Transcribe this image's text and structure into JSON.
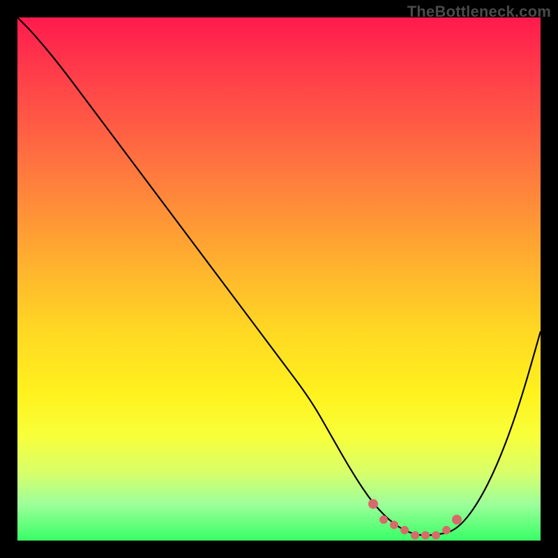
{
  "watermark": "TheBottleneck.com",
  "colors": {
    "frame": "#000000",
    "curve": "#000000",
    "marker": "#d76a6a"
  },
  "chart_data": {
    "type": "line",
    "title": "",
    "xlabel": "",
    "ylabel": "",
    "xlim": [
      0,
      100
    ],
    "ylim": [
      0,
      100
    ],
    "grid": false,
    "legend": false,
    "series": [
      {
        "name": "bottleneck-curve",
        "x": [
          0,
          3,
          8,
          14,
          20,
          26,
          32,
          38,
          44,
          50,
          56,
          60,
          64,
          68,
          72,
          76,
          80,
          84,
          88,
          92,
          96,
          100
        ],
        "values": [
          100,
          97,
          91,
          83,
          75,
          67,
          59,
          51,
          43,
          35,
          27,
          20,
          13,
          7,
          3,
          1,
          1,
          2,
          7,
          15,
          26,
          40
        ]
      }
    ],
    "markers": [
      {
        "name": "sweet-spot-start",
        "x": 68,
        "y": 7
      },
      {
        "name": "sweet-spot",
        "x": 70,
        "y": 4
      },
      {
        "name": "sweet-spot",
        "x": 72,
        "y": 3
      },
      {
        "name": "sweet-spot",
        "x": 74,
        "y": 2
      },
      {
        "name": "sweet-spot",
        "x": 76,
        "y": 1
      },
      {
        "name": "sweet-spot",
        "x": 78,
        "y": 1
      },
      {
        "name": "sweet-spot",
        "x": 80,
        "y": 1
      },
      {
        "name": "sweet-spot",
        "x": 82,
        "y": 2
      },
      {
        "name": "sweet-spot-end",
        "x": 84,
        "y": 4
      }
    ]
  }
}
